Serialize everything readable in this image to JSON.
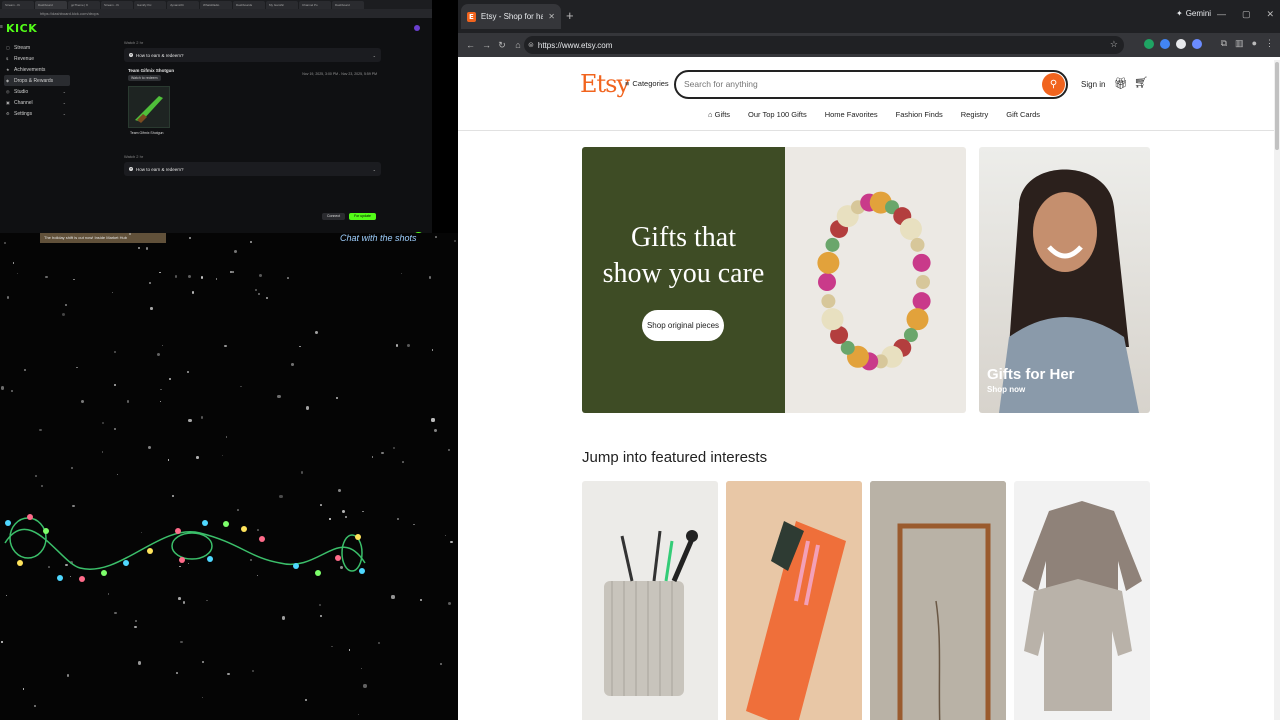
{
  "kick": {
    "tabs": [
      "Stream - Ki",
      "Dashboard",
      "goTheme | K",
      "Stream - Ki",
      "Gamify Kic",
      "dynamicKi",
      "WhatsRadio",
      "Dashboards",
      "My Gamific",
      "Channel Po",
      "Dashboard",
      "+"
    ],
    "url": "https://dashboard.kick.com/drops",
    "logo": "KICK",
    "sidebar": [
      {
        "label": "Stream",
        "icon": "stream-icon"
      },
      {
        "label": "Revenue",
        "icon": "revenue-icon"
      },
      {
        "label": "Achievements",
        "icon": "achievements-icon"
      },
      {
        "label": "Drops & Rewards",
        "icon": "drops-icon"
      },
      {
        "label": "Studio",
        "icon": "studio-icon"
      },
      {
        "label": "Channel",
        "icon": "channel-icon"
      },
      {
        "label": "Settings",
        "icon": "settings-icon"
      }
    ],
    "section1_label": "Watch 2 hr",
    "faq1": "How to earn & redeem?",
    "drop_title": "Team Gifmix Shotgun",
    "drop_dates": "Nov 19, 2025, 3:00 PM - Nov 23, 2025, 5:59 PM",
    "watch_btn": "Watch to redeem",
    "item_name": "Team Gifmix Shotgun",
    "section2_label": "Watch 2 hr",
    "faq2": "How to earn & redeem?",
    "connect_btn": "Connect",
    "forupdate_btn": "For update"
  },
  "stream": {
    "banner": "The holiday shift is out now! Inside Market Hub",
    "overlay_text": "Chat with the shots"
  },
  "chrome": {
    "tab_title": "Etsy - Shop for handmade, vintage",
    "gemini": "Gemini",
    "url": "https://www.etsy.com"
  },
  "etsy": {
    "logo": "Etsy",
    "categories": "Categories",
    "search_placeholder": "Search for anything",
    "signin": "Sign in",
    "nav": [
      "Gifts",
      "Our Top 100 Gifts",
      "Home Favorites",
      "Fashion Finds",
      "Registry",
      "Gift Cards"
    ],
    "hero": {
      "title_line1": "Gifts that",
      "title_line2": "show you care",
      "button": "Shop original pieces"
    },
    "promo": {
      "title": "Gifts for Her",
      "subtitle": "Shop now"
    },
    "interests_title": "Jump into featured interests",
    "colors": {
      "brand": "#f1641e",
      "hero_green": "#3e4c25"
    }
  }
}
